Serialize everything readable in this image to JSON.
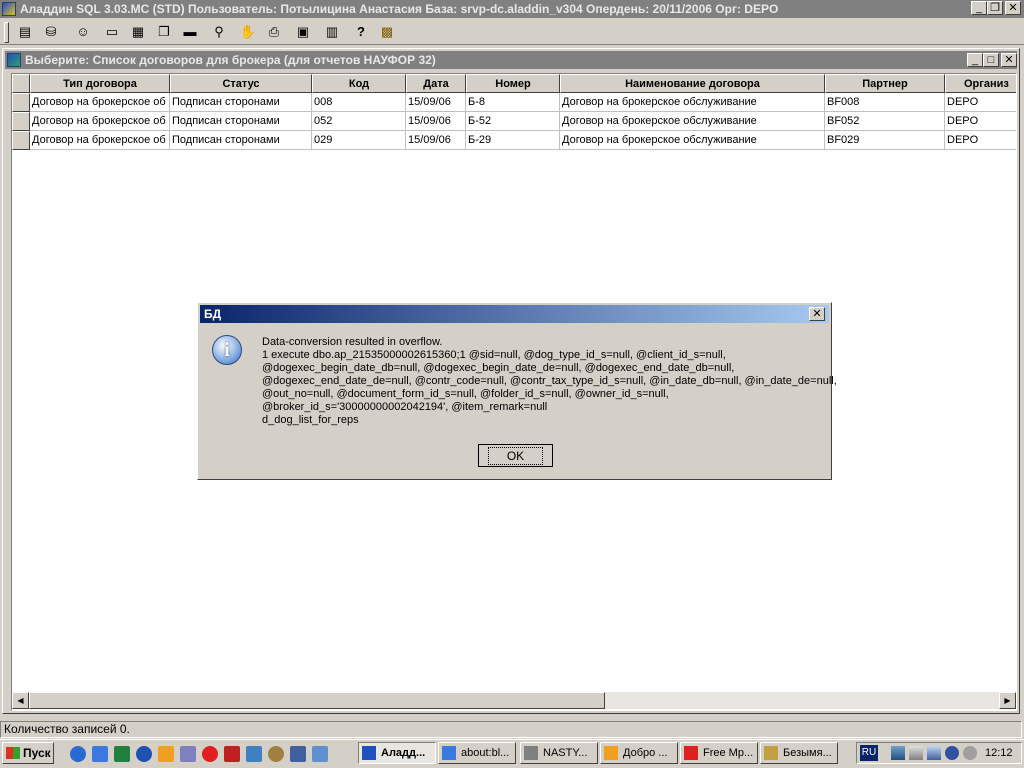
{
  "app": {
    "title": "Аладдин SQL 3.03.MC (STD)  Пользователь: Потылицина Анастасия  База: srvp-dc.aladdin_v304  Опердень: 20/11/2006  Орг: DEPO"
  },
  "toolbar": {
    "icons": [
      "report-icon",
      "db-icon",
      "user-search-icon",
      "window-icon",
      "tile-icon",
      "cascade-icon",
      "minimize-all-icon",
      "find-icon",
      "stop-hand-icon",
      "print-icon",
      "save-icon",
      "calendar-icon",
      "help-icon",
      "exit-icon"
    ]
  },
  "child": {
    "title": "Выберите: Список договоров для брокера (для отчетов НАУФОР 32)"
  },
  "grid": {
    "columns": [
      "Тип договора",
      "Статус",
      "Код",
      "Дата",
      "Номер",
      "Наименование договора",
      "Партнер",
      "Организ"
    ],
    "rows": [
      [
        "Договор на брокерское об",
        "Подписан сторонами",
        "008",
        "15/09/06",
        "Б-8",
        "Договор на брокерское обслуживание",
        "BF008",
        "DEPO"
      ],
      [
        "Договор на брокерское об",
        "Подписан сторонами",
        "052",
        "15/09/06",
        "Б-52",
        "Договор на брокерское обслуживание",
        "BF052",
        "DEPO"
      ],
      [
        "Договор на брокерское об",
        "Подписан сторонами",
        "029",
        "15/09/06",
        "Б-29",
        "Договор на брокерское обслуживание",
        "BF029",
        "DEPO"
      ]
    ]
  },
  "status": {
    "text": "Количество записей 0."
  },
  "dialog": {
    "title": "БД",
    "message_lines": [
      "Data-conversion resulted in overflow.",
      "1 execute dbo.ap_21535000002615360;1 @sid=null, @dog_type_id_s=null, @client_id_s=null,",
      "@dogexec_begin_date_db=null, @dogexec_begin_date_de=null, @dogexec_end_date_db=null,",
      "@dogexec_end_date_de=null, @contr_code=null, @contr_tax_type_id_s=null, @in_date_db=null, @in_date_de=null,",
      "@out_no=null, @document_form_id_s=null, @folder_id_s=null, @owner_id_s=null,",
      "@broker_id_s='30000000002042194', @item_remark=null",
      "d_dog_list_for_reps"
    ],
    "ok_label": "OK"
  },
  "taskbar": {
    "start_label": "Пуск",
    "tasks": [
      "Аладд...",
      "about:bl...",
      "NASTY...",
      "Добро ...",
      "Free Mp...",
      "Безымя..."
    ],
    "lang": "RU",
    "clock": "12:12"
  },
  "colors": {
    "titlebar_inactive": "#808080",
    "titlebar_active_start": "#0a246a",
    "titlebar_active_end": "#a6caf0",
    "desktop": "#d4d0c8"
  }
}
